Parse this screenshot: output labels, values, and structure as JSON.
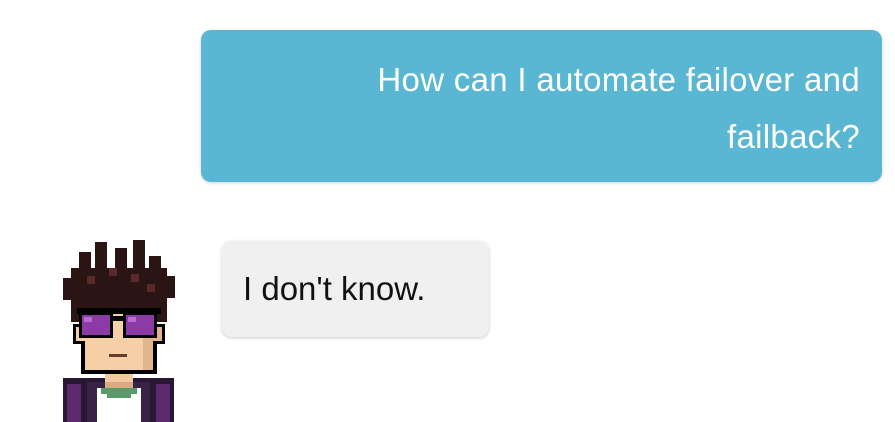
{
  "conversation": {
    "user_message": "How can I automate failover and failback?",
    "bot_message": "I don't know."
  },
  "avatar": {
    "icon": "pixel-art-character-with-sunglasses-icon"
  },
  "colors": {
    "user_bubble": "#5ab7d3",
    "bot_bubble": "#f0f0f0",
    "user_text": "#ffffff",
    "bot_text": "#111111"
  }
}
